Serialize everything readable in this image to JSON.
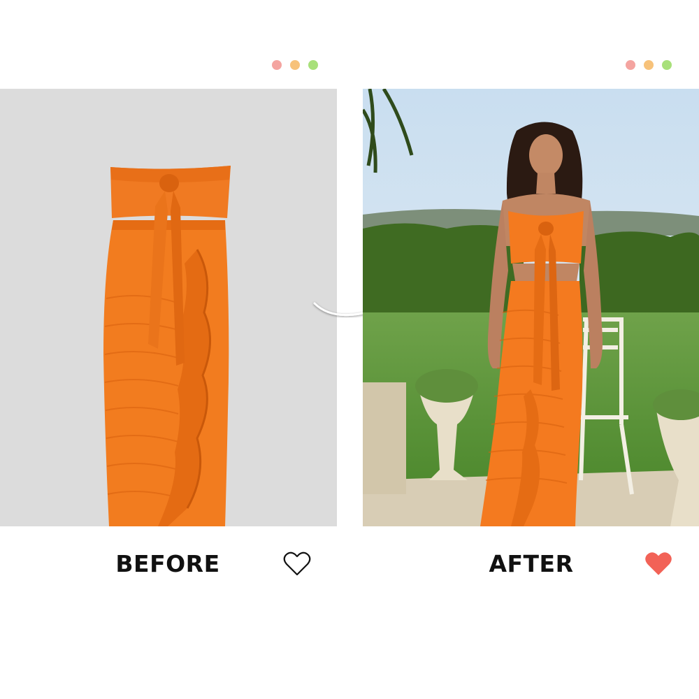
{
  "before": {
    "label": "BEFORE",
    "icon": "heart-outline-icon",
    "background_color": "#dcdcdc"
  },
  "after": {
    "label": "AFTER",
    "icon": "heart-filled-icon",
    "heart_color": "#f26257"
  },
  "window_dots": {
    "colors": [
      "#f4a4a0",
      "#f7c27a",
      "#a8e07a"
    ]
  },
  "accent_color": "#f47a1f"
}
